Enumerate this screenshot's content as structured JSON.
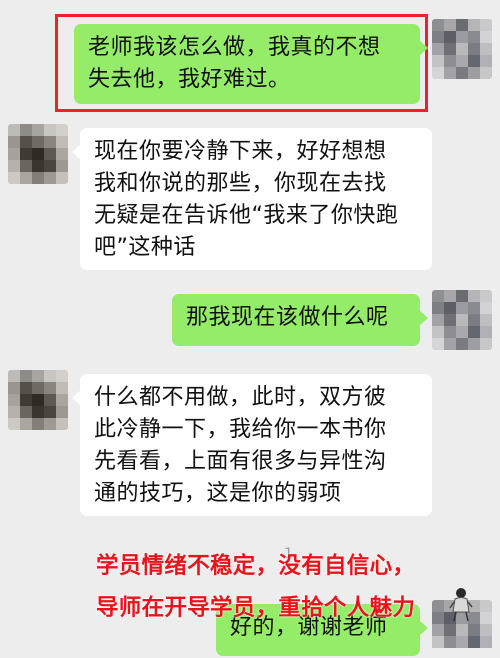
{
  "messages": [
    {
      "side": "right",
      "lines": [
        "老师我该怎么做，我真的不想",
        "失去他，我好难过。"
      ]
    },
    {
      "side": "left",
      "lines": [
        "现在你要冷静下来，好好想想",
        "我和你说的那些，你现在去找",
        "无疑是在告诉他“我来了你快跑",
        "吧”这种话"
      ]
    },
    {
      "side": "right",
      "lines": [
        "那我现在该做什么呢"
      ]
    },
    {
      "side": "left",
      "lines": [
        "什么都不用做，此时，双方彼",
        "此冷静一下，我给你一本书你",
        "先看看，上面有很多与异性沟",
        "通的技巧，这是你的弱项"
      ]
    },
    {
      "side": "right",
      "lines": [
        "好的，谢谢老师"
      ]
    }
  ],
  "annotations": {
    "line1": "学员情绪不稳定，没有自信心，",
    "line2": "导师在开导学员，重拾个人魅力"
  },
  "partial_number": "1",
  "colors": {
    "sent_bubble": "#95ec69",
    "received_bubble": "#ffffff",
    "background": "#ededed",
    "annotation_red": "#e8141c",
    "highlight_border": "#e8232a"
  },
  "icons": {
    "avatar_self": "blurred-avatar",
    "avatar_teacher": "blurred-avatar",
    "corner_figure": "person-figure-icon"
  }
}
